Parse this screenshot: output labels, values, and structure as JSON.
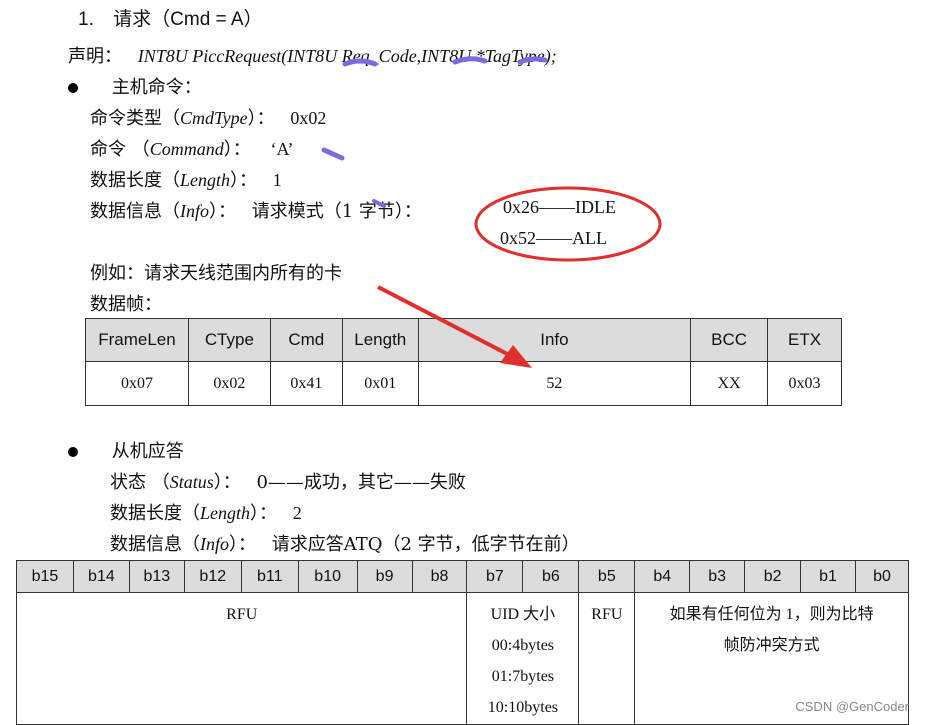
{
  "heading": {
    "number": "1.",
    "text": "请求（Cmd = A）"
  },
  "declaration": {
    "label": "声明：",
    "signature": "INT8U PiccRequest(INT8U Req_Code,INT8U *TagType);"
  },
  "host": {
    "bullet_title": "主机命令：",
    "cmdtype": {
      "label": "命令类型（",
      "term": "CmdType",
      "close": "）：",
      "value": "0x02"
    },
    "command": {
      "label": "命令 （",
      "term": "Command",
      "close": "）：",
      "value": "‘A’"
    },
    "length": {
      "label": "数据长度（",
      "term": "Length",
      "close": "）：",
      "value": "1"
    },
    "info": {
      "label": "数据信息（",
      "term": "Info",
      "close": "）：",
      "desc": "请求模式（1 字节）：",
      "opt1": "0x26——IDLE",
      "opt2": "0x52——ALL"
    },
    "example": "例如：请求天线范围内所有的卡",
    "frame_label": "数据帧："
  },
  "frame_table": {
    "headers": [
      "FrameLen",
      "CType",
      "Cmd",
      "Length",
      "Info",
      "BCC",
      "ETX"
    ],
    "row": [
      "0x07",
      "0x02",
      "0x41",
      "0x01",
      "52",
      "XX",
      "0x03"
    ]
  },
  "slave": {
    "bullet_title": "从机应答",
    "status": {
      "label": "状态 （",
      "term": "Status",
      "close": "）：",
      "value": "0——成功，其它——失败"
    },
    "length": {
      "label": "数据长度（",
      "term": "Length",
      "close": "）：",
      "value": "2"
    },
    "info": {
      "label": "数据信息（",
      "term": "Info",
      "close": "）：",
      "value": "请求应答ATQ（2 字节，低字节在前）"
    }
  },
  "bits_table": {
    "headers": [
      "b15",
      "b14",
      "b13",
      "b12",
      "b11",
      "b10",
      "b9",
      "b8",
      "b7",
      "b6",
      "b5",
      "b4",
      "b3",
      "b2",
      "b1",
      "b0"
    ],
    "rfu_high": "RFU",
    "uid_lines": [
      "UID 大小",
      "00:4bytes",
      "01:7bytes",
      "10:10bytes"
    ],
    "rfu_b5": "RFU",
    "anticoll_lines": [
      "如果有任何位为 1，则为比特",
      "帧防冲突方式"
    ]
  },
  "watermark": "CSDN @GenCoder",
  "colors": {
    "annotation_red": "#e0302e",
    "table_header_bg": "#dcdcdc",
    "highlight_purple": "#7b6be0"
  }
}
